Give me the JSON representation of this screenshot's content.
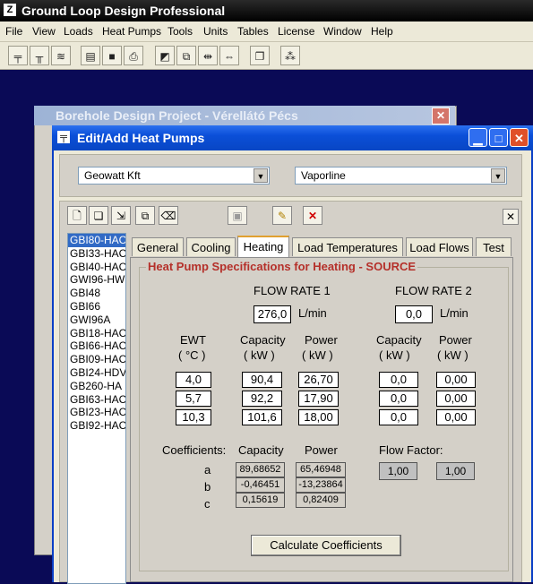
{
  "app": {
    "title": "Ground Loop Design Professional",
    "menu": [
      "File",
      "View",
      "Loads",
      "Heat Pumps",
      "Tools",
      "Units",
      "Tables",
      "License",
      "Window",
      "Help"
    ]
  },
  "background_window": {
    "title": "Borehole Design Project - Vérellátó Pécs"
  },
  "dialog": {
    "title": "Edit/Add Heat Pumps",
    "manufacturer": "Geowatt Kft",
    "series": "Vaporline",
    "models": [
      "GBI80-HAC",
      "GBI33-HAC",
      "GBI40-HAC",
      "GWI96-HW",
      "GBI48",
      "GBI66",
      "GWI96A",
      "GBI18-HAC",
      "GBI66-HAC",
      "GBI09-HAC",
      "GBI24-HDV",
      "GB260-HA",
      "GBI63-HAC",
      "GBI23-HAC",
      "GBI92-HAC"
    ],
    "tabs": [
      "General",
      "Cooling",
      "Heating",
      "Load Temperatures",
      "Load Flows",
      "Test"
    ],
    "active_tab": "Heating",
    "group_title": "Heat Pump Specifications for Heating - SOURCE",
    "flow_rate_1": {
      "label": "FLOW RATE 1",
      "value": "276,0",
      "unit": "L/min"
    },
    "flow_rate_2": {
      "label": "FLOW RATE 2",
      "value": "0,0",
      "unit": "L/min"
    },
    "headers": {
      "ewt": "EWT",
      "ewt_unit": "( °C )",
      "capacity": "Capacity",
      "capacity_unit": "( kW )",
      "power": "Power",
      "power_unit": "( kW )"
    },
    "ewt": [
      "4,0",
      "5,7",
      "10,3"
    ],
    "fr1_capacity": [
      "90,4",
      "92,2",
      "101,6"
    ],
    "fr1_power": [
      "26,70",
      "17,90",
      "18,00"
    ],
    "fr2_capacity": [
      "0,0",
      "0,0",
      "0,0"
    ],
    "fr2_power": [
      "0,00",
      "0,00",
      "0,00"
    ],
    "coefficients": {
      "label": "Coefficients:",
      "capacity_label": "Capacity",
      "power_label": "Power",
      "rows": [
        "a",
        "b",
        "c"
      ],
      "capacity": [
        "89,68652",
        "-0,46451",
        "0,15619"
      ],
      "power": [
        "65,46948",
        "-13,23864",
        "0,82409"
      ]
    },
    "flow_factor": {
      "label": "Flow Factor:",
      "values": [
        "1,00",
        "1,00"
      ]
    },
    "calculate_label": "Calculate Coefficients"
  }
}
